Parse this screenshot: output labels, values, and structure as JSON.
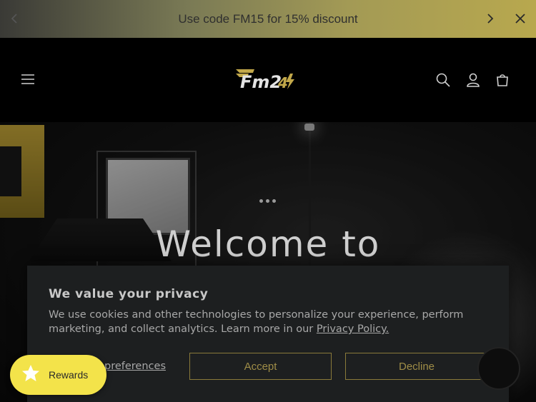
{
  "announcement": {
    "text": "Use code FM15 for 15% discount",
    "prev_icon": "chevron-left-icon",
    "next_icon": "chevron-right-icon",
    "close_icon": "close-icon"
  },
  "header": {
    "menu_icon": "hamburger-menu-icon",
    "logo_text": "FM24",
    "icons": [
      "search-icon",
      "account-icon",
      "cart-icon"
    ]
  },
  "hero": {
    "title": "Welcome to"
  },
  "cookie_banner": {
    "title": "We value your privacy",
    "text": "We use cookies and other technologies to personalize your experience, perform marketing, and collect analytics. Learn more in our",
    "policy_link": "Privacy Policy.",
    "preferences_label": "preferences",
    "accept_label": "Accept",
    "decline_label": "Decline"
  },
  "rewards": {
    "label": "Rewards",
    "icon": "star-icon"
  },
  "chat": {
    "icon": "chat-icon"
  },
  "colors": {
    "accent_gold": "#9f8d47",
    "rewards_yellow": "#f3e34a",
    "banner_bg": "#1d1f20"
  }
}
